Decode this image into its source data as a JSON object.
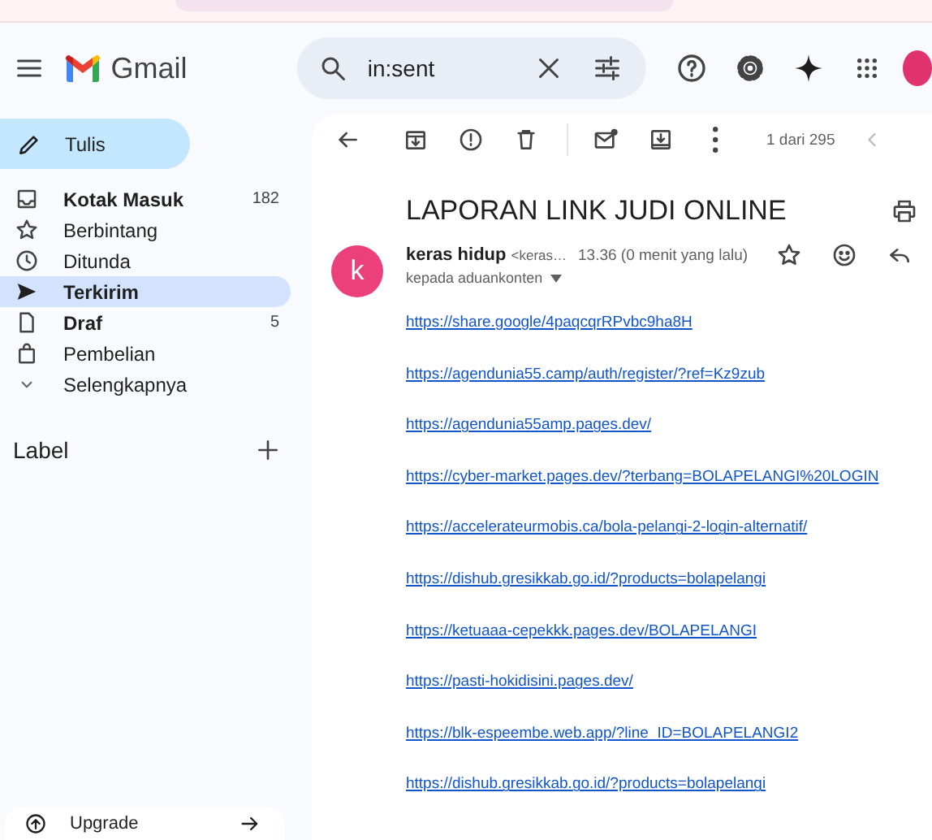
{
  "app": {
    "name": "Gmail"
  },
  "search": {
    "value": "in:sent"
  },
  "compose": {
    "label": "Tulis"
  },
  "sidebar": {
    "items": [
      {
        "label": "Kotak Masuk",
        "count": "182",
        "unread": true,
        "selected": false
      },
      {
        "label": "Berbintang",
        "unread": false,
        "selected": false
      },
      {
        "label": "Ditunda",
        "unread": false,
        "selected": false
      },
      {
        "label": "Terkirim",
        "unread": false,
        "selected": true
      },
      {
        "label": "Draf",
        "count": "5",
        "unread": true,
        "selected": false
      },
      {
        "label": "Pembelian",
        "unread": false,
        "selected": false
      },
      {
        "label": "Selengkapnya",
        "unread": false,
        "selected": false
      }
    ]
  },
  "labels": {
    "heading": "Label"
  },
  "upgrade": {
    "label": "Upgrade"
  },
  "toolbar": {
    "pager": "1 dari 295"
  },
  "message": {
    "subject": "LAPORAN LINK JUDI ONLINE",
    "sender": {
      "initial": "k",
      "name": "keras hidup",
      "email": "<keras…"
    },
    "time": "13.36 (0 menit yang lalu)",
    "recipients": "kepada aduankonten",
    "links": [
      "https://share.google/4paqcqrRPvbc9ha8H",
      "https://agendunia55.camp/auth/register/?ref=Kz9zub",
      "https://agendunia55amp.pages.dev/",
      "https://cyber-market.pages.dev/?terbang=BOLAPELANGI%20LOGIN",
      "https://accelerateurmobis.ca/bola-pelangi-2-login-alternatif/",
      "https://dishub.gresikkab.go.id/?products=bolapelangi",
      "https://ketuaaa-cepekkk.pages.dev/BOLAPELANGI",
      "https://pasti-hokidisini.pages.dev/",
      "https://blk-espeembe.web.app/?line_ID=BOLAPELANGI2",
      "https://dishub.gresikkab.go.id/?products=bolapelangi"
    ]
  }
}
